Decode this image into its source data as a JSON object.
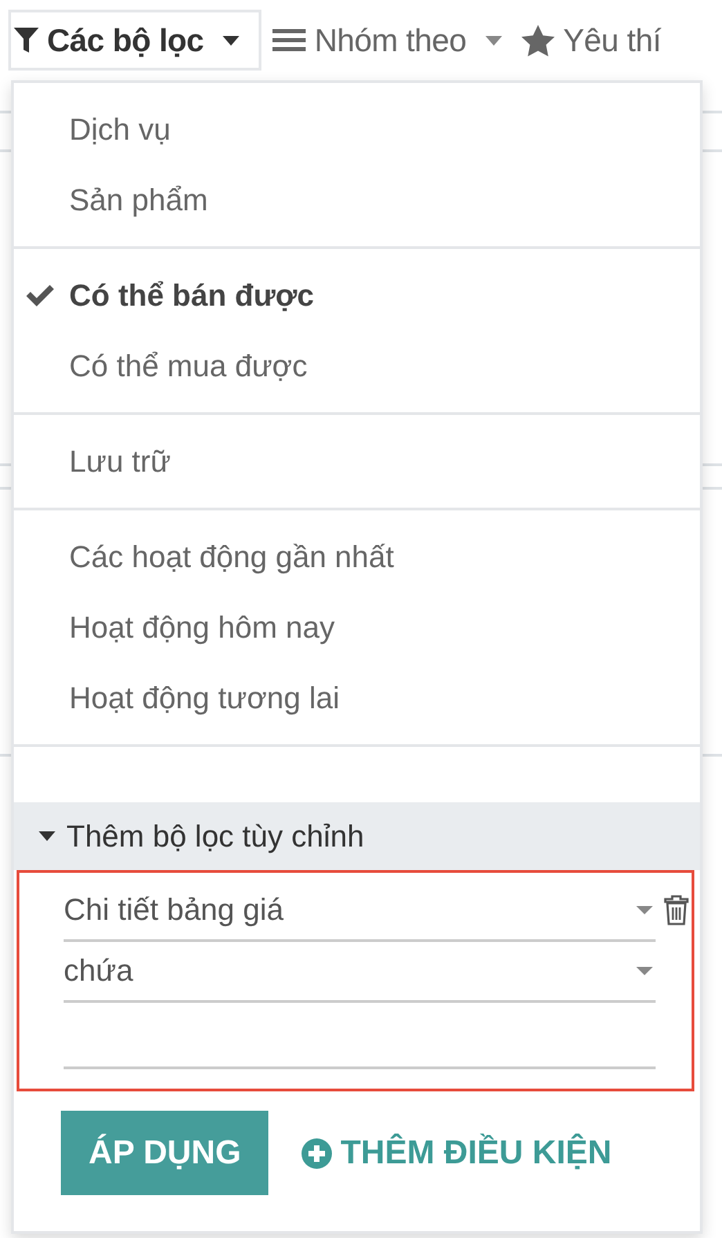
{
  "toolbar": [
    {
      "kind": "filter",
      "label": "Các bộ lọc",
      "selected": true
    },
    {
      "kind": "group",
      "label": "Nhóm theo",
      "selected": false
    },
    {
      "kind": "favorites",
      "label": "Yêu thí",
      "selected": false
    }
  ],
  "filter_groups": [
    [
      {
        "label": "Dịch vụ",
        "checked": false
      },
      {
        "label": "Sản phẩm",
        "checked": false
      }
    ],
    [
      {
        "label": "Có thể bán được",
        "checked": true
      },
      {
        "label": "Có thể mua được",
        "checked": false
      }
    ],
    [
      {
        "label": "Lưu trữ",
        "checked": false
      }
    ],
    [
      {
        "label": "Các hoạt động gần nhất",
        "checked": false
      },
      {
        "label": "Hoạt động hôm nay",
        "checked": false
      },
      {
        "label": "Hoạt động tương lai",
        "checked": false
      }
    ]
  ],
  "custom_filter": {
    "label": "Thêm bộ lọc tùy chỉnh",
    "expanded": true,
    "condition": {
      "field": "Chi tiết bảng giá",
      "operator": "chứa",
      "highlighted": true
    },
    "apply_button": "ÁP DỤNG",
    "add_condition_button": "THÊM ĐIỀU KIỆN"
  }
}
